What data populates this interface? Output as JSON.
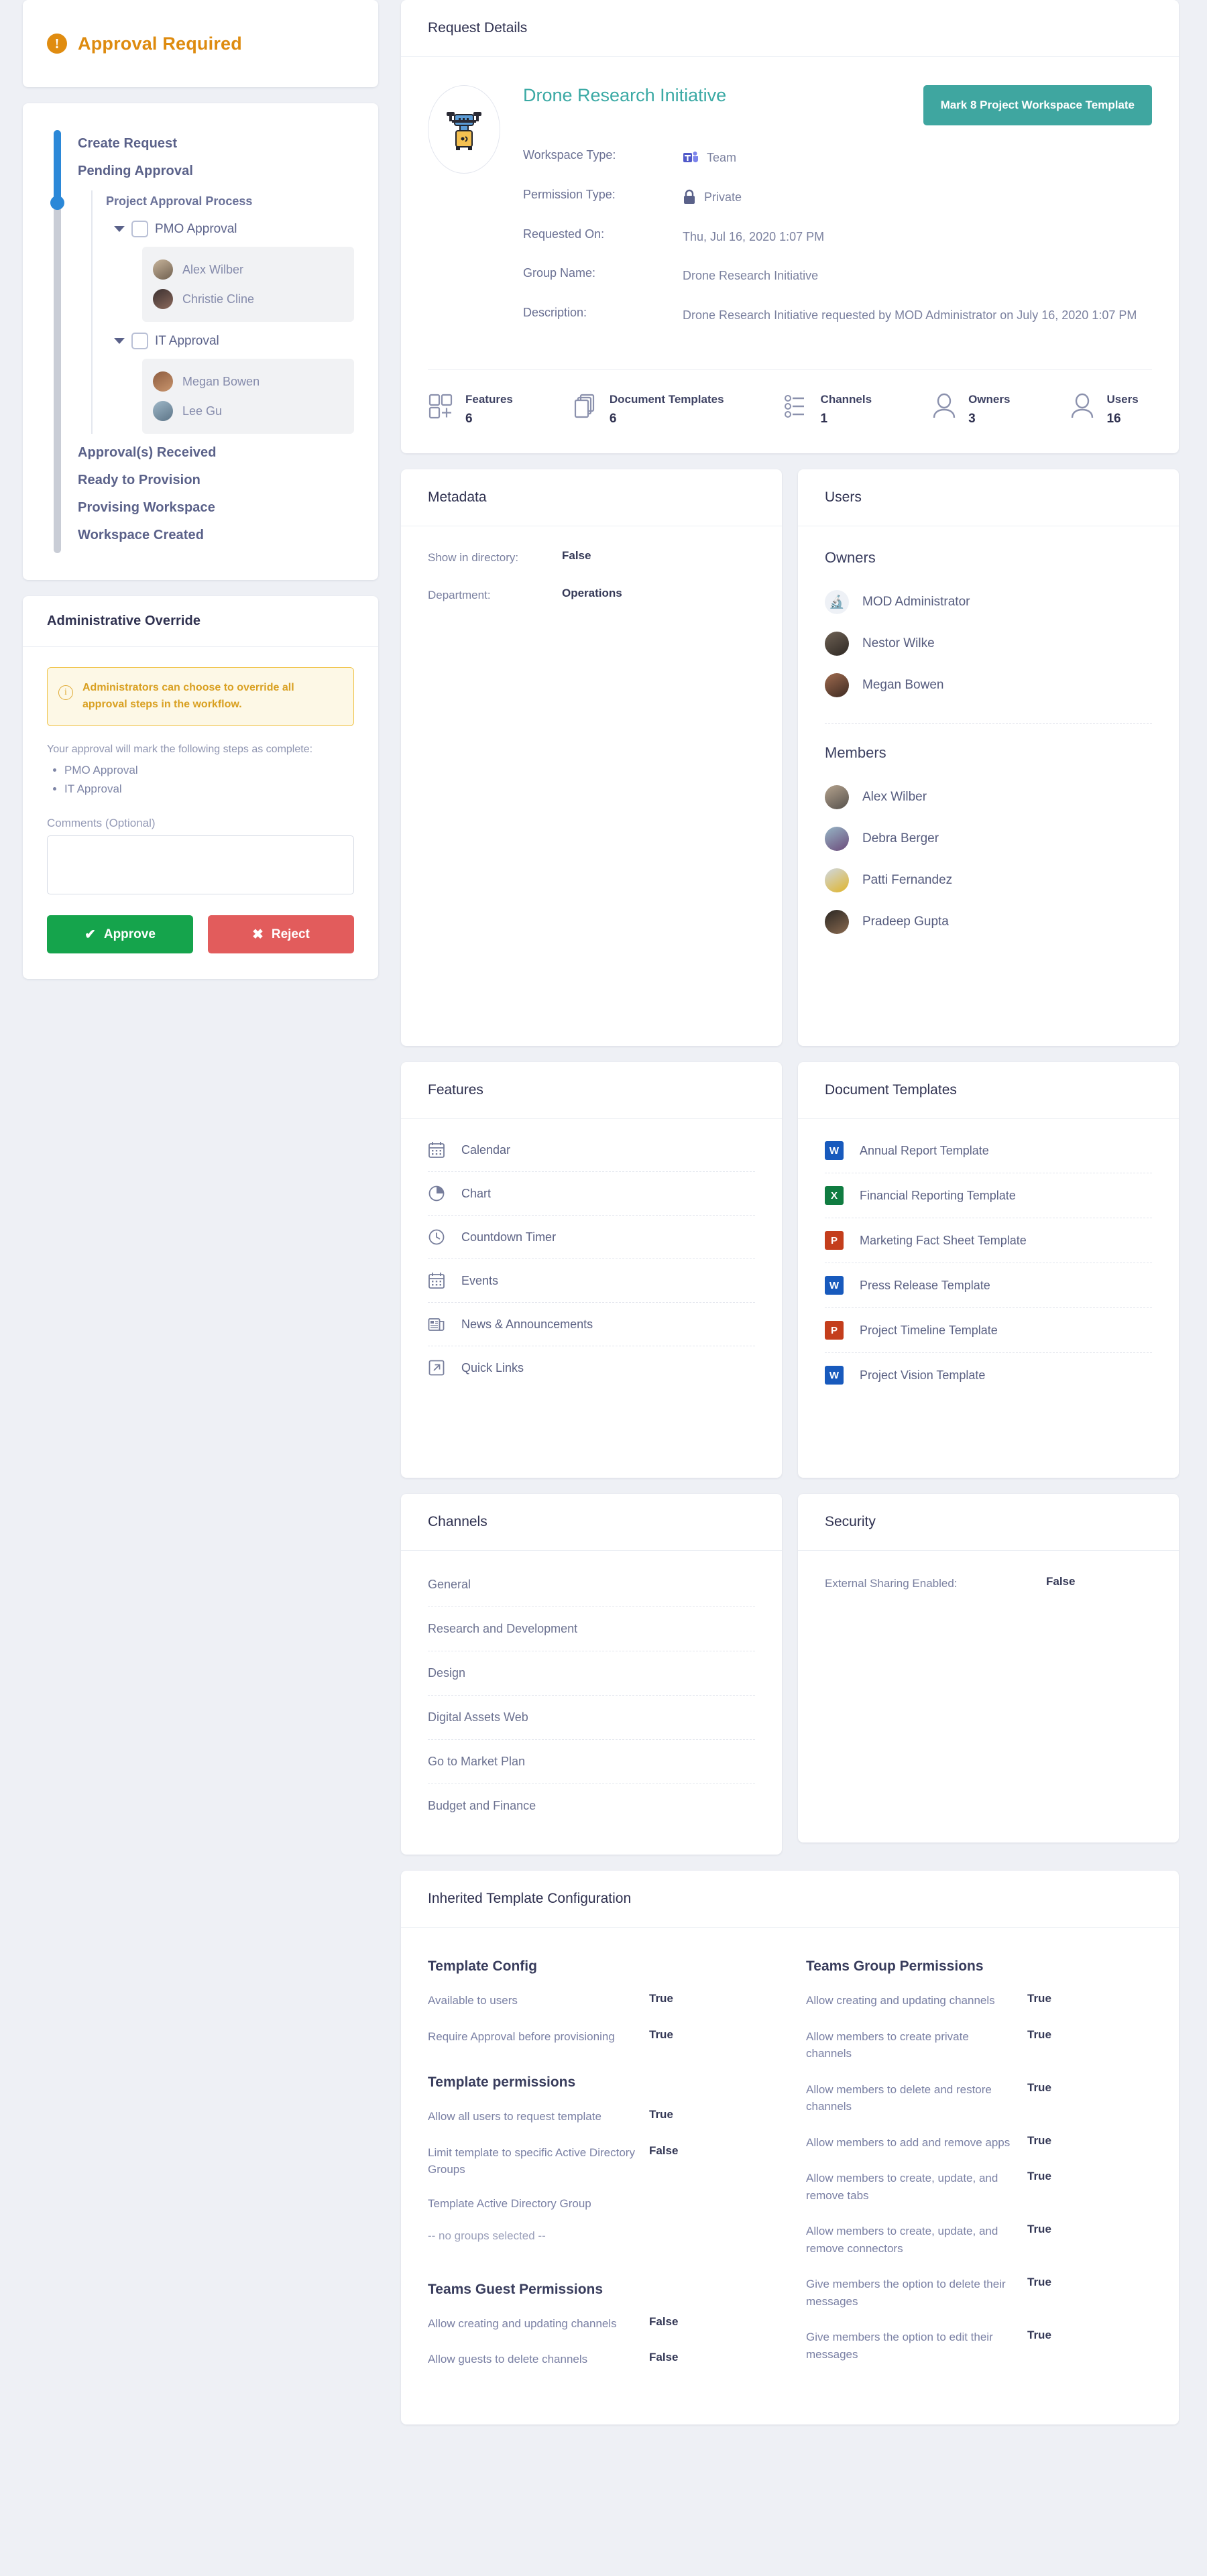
{
  "alert": {
    "title": "Approval Required",
    "icon": "exclamation-icon"
  },
  "workflow": {
    "steps_before": [
      "Create Request",
      "Pending Approval"
    ],
    "group_title": "Project Approval Process",
    "approval_groups": [
      {
        "label": "PMO Approval",
        "approvers": [
          {
            "name": "Alex Wilber"
          },
          {
            "name": "Christie Cline"
          }
        ]
      },
      {
        "label": "IT Approval",
        "approvers": [
          {
            "name": "Megan Bowen"
          },
          {
            "name": "Lee Gu"
          }
        ]
      }
    ],
    "steps_after": [
      "Approval(s) Received",
      "Ready to Provision",
      "Provising Workspace",
      "Workspace Created"
    ]
  },
  "override": {
    "title": "Administrative Override",
    "notice": "Administrators can choose to override all approval steps in the workflow.",
    "lead": "Your approval will mark the following steps as complete:",
    "steps": [
      "PMO Approval",
      "IT Approval"
    ],
    "comments_label": "Comments (Optional)",
    "comments_value": "",
    "approve_label": "Approve",
    "reject_label": "Reject"
  },
  "request_details": {
    "card_title": "Request Details",
    "workspace_name": "Drone Research Initiative",
    "template_button": "Mark 8 Project Workspace Template",
    "fields": [
      {
        "label": "Workspace Type:",
        "value": "Team",
        "icon": "teams-icon"
      },
      {
        "label": "Permission Type:",
        "value": "Private",
        "icon": "lock-icon"
      },
      {
        "label": "Requested On:",
        "value": "Thu, Jul 16, 2020 1:07 PM",
        "icon": ""
      },
      {
        "label": "Group Name:",
        "value": "Drone Research Initiative",
        "icon": ""
      },
      {
        "label": "Description:",
        "value": "Drone Research Initiative requested by MOD Administrator on July 16, 2020 1:07 PM",
        "icon": ""
      }
    ],
    "stats": [
      {
        "label": "Features",
        "value": "6",
        "icon": "features-icon"
      },
      {
        "label": "Document Templates",
        "value": "6",
        "icon": "documents-icon"
      },
      {
        "label": "Channels",
        "value": "1",
        "icon": "channels-icon"
      },
      {
        "label": "Owners",
        "value": "3",
        "icon": "owner-icon"
      },
      {
        "label": "Users",
        "value": "16",
        "icon": "user-icon"
      }
    ]
  },
  "metadata": {
    "card_title": "Metadata",
    "rows": [
      {
        "key": "Show in directory:",
        "value": "False"
      },
      {
        "key": "Department:",
        "value": "Operations"
      }
    ]
  },
  "users": {
    "card_title": "Users",
    "owners_title": "Owners",
    "owners": [
      {
        "name": "MOD Administrator",
        "avatar": "av-mod"
      },
      {
        "name": "Nestor Wilke",
        "avatar": "av-nestor"
      },
      {
        "name": "Megan Bowen",
        "avatar": "av-megan"
      }
    ],
    "members_title": "Members",
    "members": [
      {
        "name": "Alex Wilber",
        "avatar": "av-alex"
      },
      {
        "name": "Debra Berger",
        "avatar": "av-debra"
      },
      {
        "name": "Patti Fernandez",
        "avatar": "av-patti"
      },
      {
        "name": "Pradeep Gupta",
        "avatar": "av-pradeep"
      }
    ]
  },
  "features": {
    "card_title": "Features",
    "items": [
      {
        "label": "Calendar",
        "icon": "calendar-icon"
      },
      {
        "label": "Chart",
        "icon": "pie-chart-icon"
      },
      {
        "label": "Countdown Timer",
        "icon": "clock-icon"
      },
      {
        "label": "Events",
        "icon": "calendar-icon"
      },
      {
        "label": "News & Announcements",
        "icon": "newspaper-icon"
      },
      {
        "label": "Quick Links",
        "icon": "external-link-icon"
      }
    ]
  },
  "doc_templates": {
    "card_title": "Document Templates",
    "items": [
      {
        "label": "Annual Report Template",
        "icon": "word-icon",
        "kind": "word",
        "letter": "W"
      },
      {
        "label": "Financial Reporting Template",
        "icon": "excel-icon",
        "kind": "excel",
        "letter": "X"
      },
      {
        "label": "Marketing Fact Sheet Template",
        "icon": "powerpoint-icon",
        "kind": "ppt",
        "letter": "P"
      },
      {
        "label": "Press Release Template",
        "icon": "word-icon",
        "kind": "word",
        "letter": "W"
      },
      {
        "label": "Project Timeline Template",
        "icon": "powerpoint-icon",
        "kind": "ppt",
        "letter": "P"
      },
      {
        "label": "Project Vision Template",
        "icon": "word-icon",
        "kind": "word",
        "letter": "W"
      }
    ]
  },
  "channels": {
    "card_title": "Channels",
    "items": [
      "General",
      "Research and Development",
      "Design",
      "Digital Assets Web",
      "Go to Market Plan",
      "Budget and Finance"
    ]
  },
  "security": {
    "card_title": "Security",
    "rows": [
      {
        "key": "External Sharing Enabled:",
        "value": "False"
      }
    ]
  },
  "inherited": {
    "card_title": "Inherited Template Configuration",
    "template_config": {
      "heading": "Template Config",
      "rows": [
        {
          "key": "Available to users",
          "value": "True"
        },
        {
          "key": "Require Approval before provisioning",
          "value": "True"
        }
      ]
    },
    "template_permissions": {
      "heading": "Template permissions",
      "rows": [
        {
          "key": "Allow all users to request template",
          "value": "True"
        },
        {
          "key": "Limit template to specific Active Directory Groups",
          "value": "False"
        }
      ],
      "ad_group_label": "Template Active Directory Group",
      "ad_group_value": "-- no groups selected --"
    },
    "guest_permissions": {
      "heading": "Teams Guest Permissions",
      "rows": [
        {
          "key": "Allow creating and updating channels",
          "value": "False"
        },
        {
          "key": "Allow guests to delete channels",
          "value": "False"
        }
      ]
    },
    "group_permissions": {
      "heading": "Teams Group Permissions",
      "rows": [
        {
          "key": "Allow creating and updating channels",
          "value": "True"
        },
        {
          "key": "Allow members to create private channels",
          "value": "True"
        },
        {
          "key": "Allow members to delete and restore channels",
          "value": "True"
        },
        {
          "key": "Allow members to add and remove apps",
          "value": "True"
        },
        {
          "key": "Allow members to create, update, and remove tabs",
          "value": "True"
        },
        {
          "key": "Allow members to create, update, and remove connectors",
          "value": "True"
        },
        {
          "key": "Give members the option to delete their messages",
          "value": "True"
        },
        {
          "key": "Give members the option to edit their messages",
          "value": "True"
        }
      ]
    }
  },
  "colors": {
    "alert_orange": "#de8b0f",
    "accent_teal": "#3fa6a0",
    "rail_blue": "#2b88d8",
    "approve_green": "#15a44c",
    "reject_red": "#e25c5c",
    "page_bg": "#eef0f5"
  }
}
